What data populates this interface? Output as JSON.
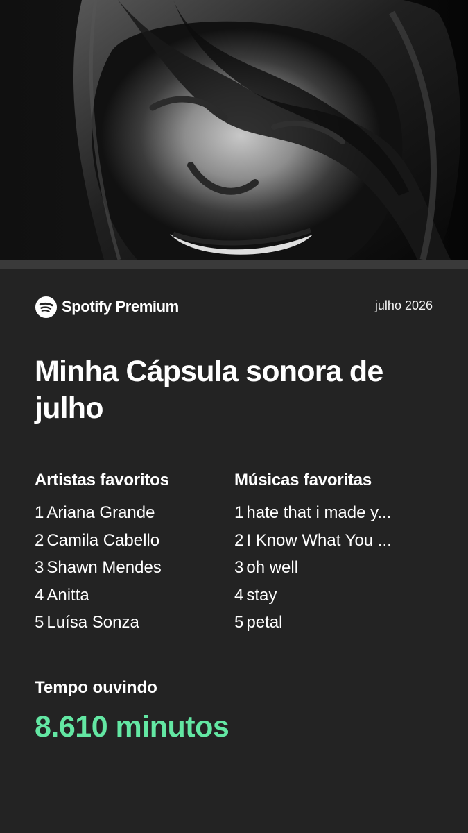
{
  "hero": {
    "icon": "black-and-white-portrait-image"
  },
  "header": {
    "brand": "Spotify Premium",
    "brand_icon": "spotify-icon",
    "date": "julho 2026"
  },
  "title": "Minha Cápsula sonora de julho",
  "artists": {
    "heading": "Artistas favoritos",
    "items": [
      {
        "rank": "1",
        "name": "Ariana Grande"
      },
      {
        "rank": "2",
        "name": "Camila Cabello"
      },
      {
        "rank": "3",
        "name": "Shawn Mendes"
      },
      {
        "rank": "4",
        "name": "Anitta"
      },
      {
        "rank": "5",
        "name": "Luísa Sonza"
      }
    ]
  },
  "songs": {
    "heading": "Músicas favoritas",
    "items": [
      {
        "rank": "1",
        "name": "hate that i made y..."
      },
      {
        "rank": "2",
        "name": "I Know What You ..."
      },
      {
        "rank": "3",
        "name": "oh well"
      },
      {
        "rank": "4",
        "name": "stay"
      },
      {
        "rank": "5",
        "name": "petal"
      }
    ]
  },
  "listening": {
    "label": "Tempo ouvindo",
    "value": "8.610 minutos"
  },
  "colors": {
    "background": "#232323",
    "accent": "#63e7a3",
    "text": "#ffffff"
  }
}
